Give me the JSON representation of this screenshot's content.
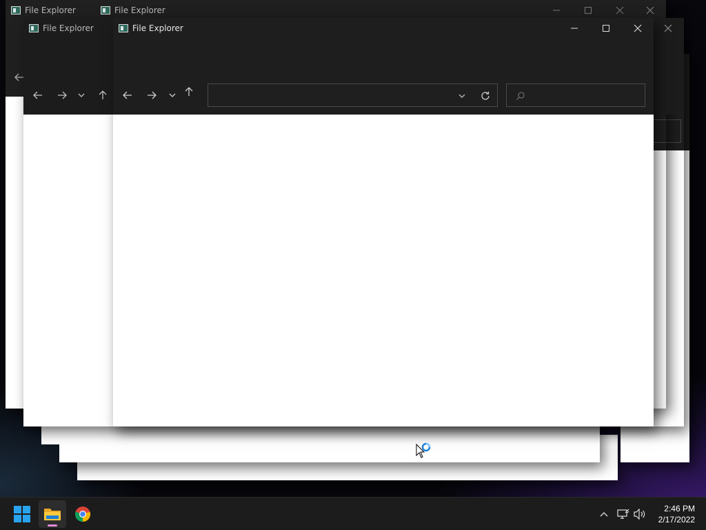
{
  "windows": [
    {
      "id": "back-1",
      "title": "File Explorer"
    },
    {
      "id": "back-2",
      "title": "File Explorer"
    },
    {
      "id": "back-3",
      "title": "File Explorer"
    },
    {
      "id": "front",
      "title": "File Explorer",
      "address_value": "",
      "search_placeholder": ""
    }
  ],
  "taskbar": {
    "apps": [
      {
        "name": "Start",
        "icon": "windows-start-icon"
      },
      {
        "name": "File Explorer",
        "icon": "folder-icon",
        "active": true
      },
      {
        "name": "Google Chrome",
        "icon": "chrome-icon"
      }
    ],
    "tray": [
      "chevron-up-icon",
      "network-icon",
      "volume-icon"
    ],
    "clock": {
      "time": "2:46 PM",
      "date": "2/17/2022"
    }
  },
  "colors": {
    "titlebar": "#1e1e1e",
    "content": "#ffffff",
    "taskbar": "#1c1c1c",
    "active_indicator": "#e58bd7",
    "start_blue": "#2aa3ef"
  }
}
